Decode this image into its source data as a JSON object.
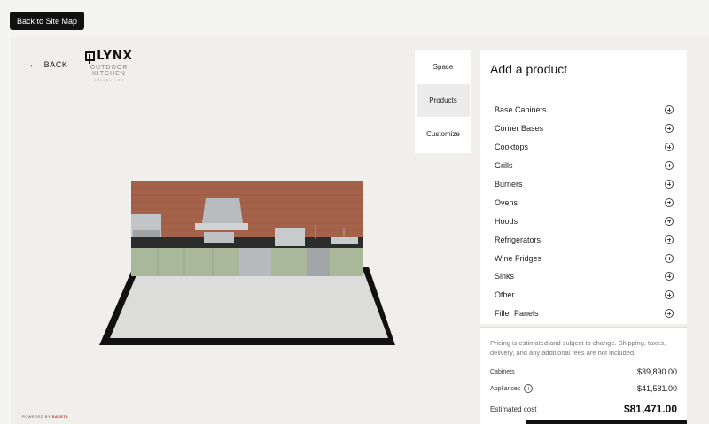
{
  "header": {
    "site_map_label": "Back to Site Map"
  },
  "app": {
    "back_label": "BACK",
    "logo": {
      "main": "LYNX",
      "sub": "OUTDOOR KITCHEN",
      "sub2": "COLLECTION"
    },
    "powered_prefix": "POWERED BY",
    "powered_brand": "SAJSTA"
  },
  "tabs": [
    {
      "label": "Space",
      "active": false
    },
    {
      "label": "Products",
      "active": true
    },
    {
      "label": "Customize",
      "active": false
    }
  ],
  "panel": {
    "title": "Add a product",
    "items": [
      "Base Cabinets",
      "Corner Bases",
      "Cooktops",
      "Grills",
      "Burners",
      "Ovens",
      "Hoods",
      "Refrigerators",
      "Wine Fridges",
      "Sinks",
      "Other",
      "Filler Panels"
    ]
  },
  "pricing": {
    "disclaimer": "Pricing is estimated and subject to change. Shipping, taxes, delivery, and any additional fees are not included.",
    "cabinets_label": "Cabinets",
    "cabinets_value": "$39,890.00",
    "appliances_label": "Appliances",
    "appliances_value": "$41,581.00",
    "estimated_label": "Estimated cost",
    "estimated_value": "$81,471.00"
  },
  "colors": {
    "cabinet_green": "#a9b89a",
    "brick": "#a5624a",
    "floor": "#dcdcda",
    "accent_dark": "#111111"
  }
}
